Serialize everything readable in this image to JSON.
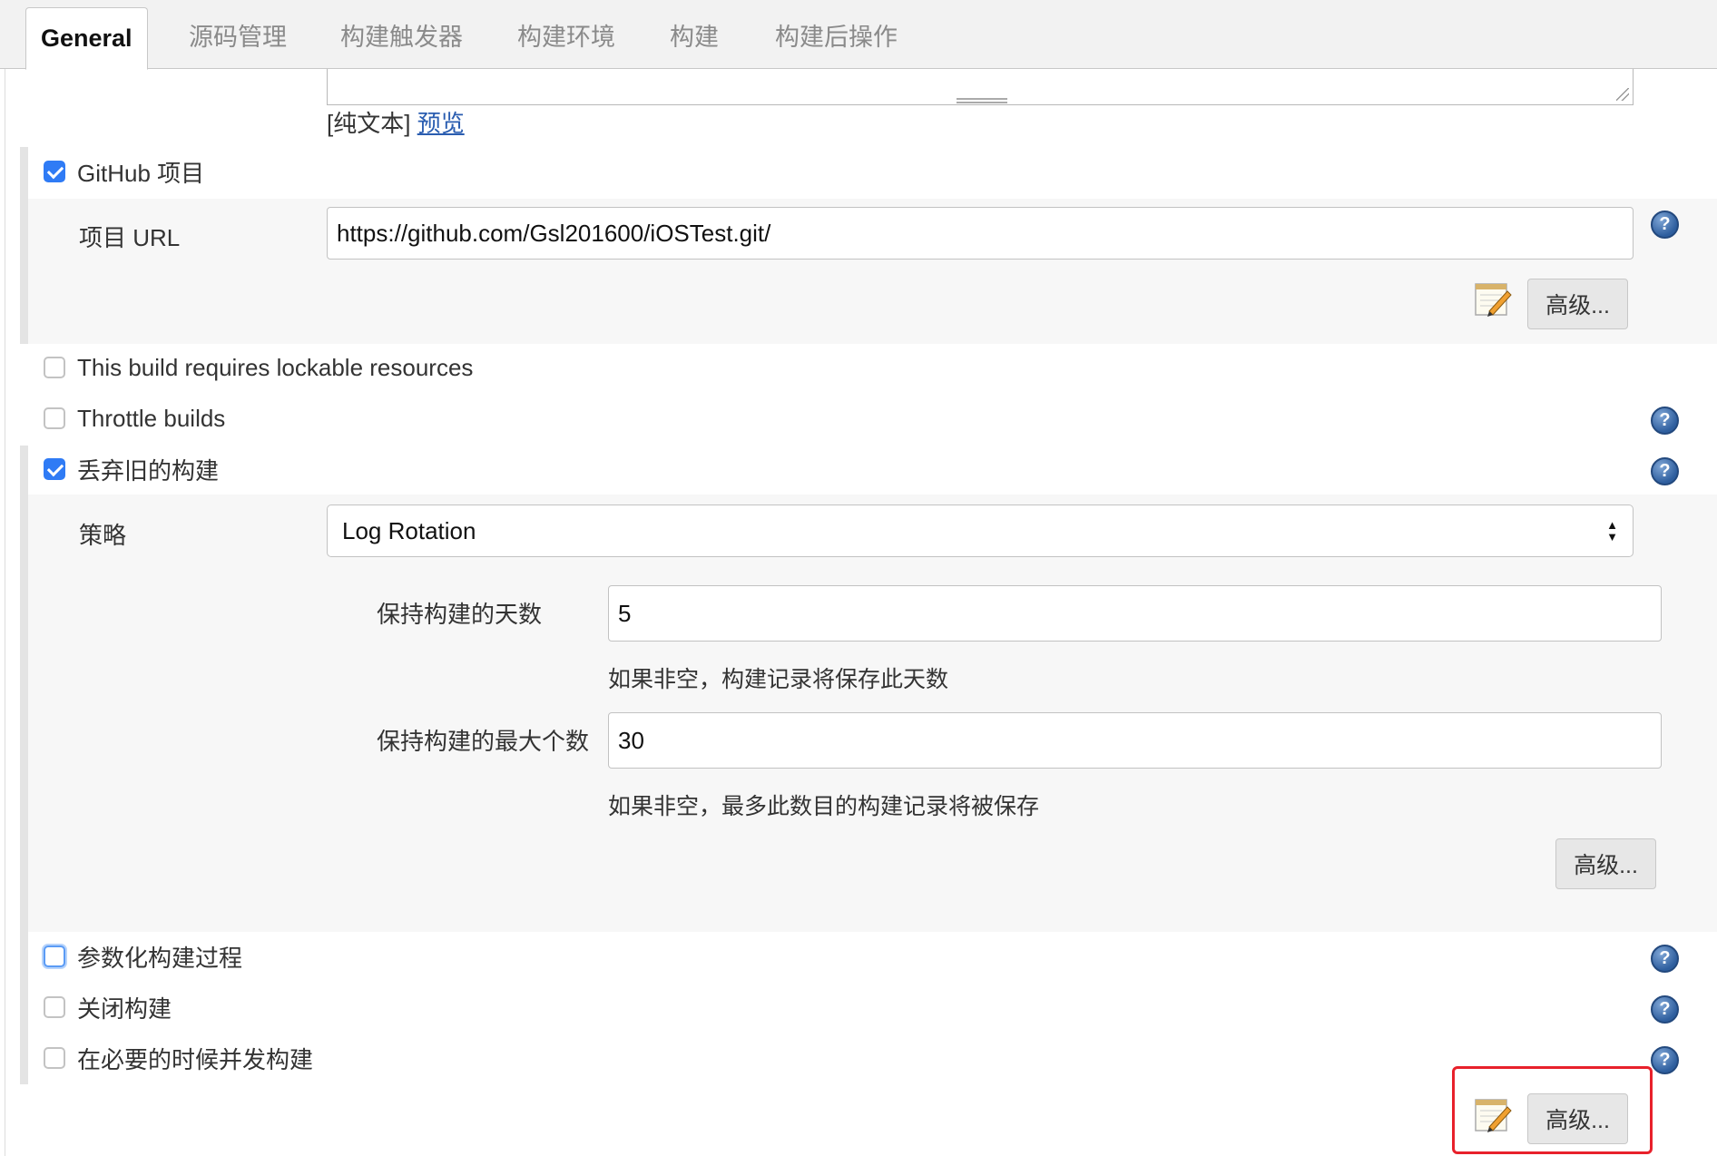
{
  "tabs": [
    "General",
    "源码管理",
    "构建触发器",
    "构建环境",
    "构建",
    "构建后操作"
  ],
  "description": {
    "plain_text_label": "[纯文本]",
    "preview_link": "预览"
  },
  "github_project": {
    "label": "GitHub 项目",
    "checked": true,
    "url_label": "项目 URL",
    "url_value": "https://github.com/Gsl201600/iOSTest.git/",
    "advanced_label": "高级..."
  },
  "lockable": {
    "label": "This build requires lockable resources",
    "checked": false
  },
  "throttle": {
    "label": "Throttle builds",
    "checked": false
  },
  "discard_old": {
    "label": "丢弃旧的构建",
    "checked": true,
    "strategy_label": "策略",
    "strategy_value": "Log Rotation",
    "days_label": "保持构建的天数",
    "days_value": "5",
    "days_hint": "如果非空，构建记录将保存此天数",
    "max_label": "保持构建的最大个数",
    "max_value": "30",
    "max_hint": "如果非空，最多此数目的构建记录将被保存",
    "advanced_label": "高级..."
  },
  "parameterized": {
    "label": "参数化构建过程",
    "checked": false
  },
  "disable_build": {
    "label": "关闭构建",
    "checked": false
  },
  "concurrent": {
    "label": "在必要的时候并发构建",
    "checked": false
  },
  "bottom_advanced_label": "高级...",
  "colors": {
    "accent": "#2f7bf5",
    "highlight": "#e8212b",
    "link": "#2a5db0"
  }
}
